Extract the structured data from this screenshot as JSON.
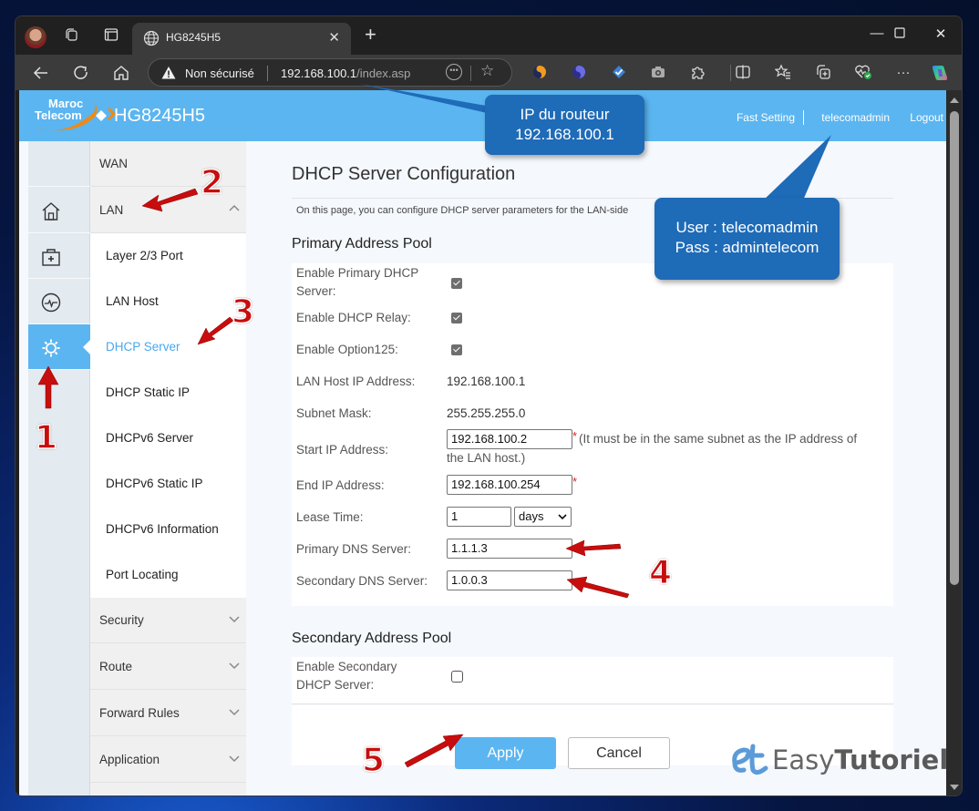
{
  "browser": {
    "tab_title": "HG8245H5",
    "security_label": "Non sécurisé",
    "url_host": "192.168.100.1",
    "url_path": "/index.asp",
    "icons": [
      "profile-avatar",
      "workspaces-icon",
      "vertical-tabs-icon",
      "globe-icon",
      "close-icon",
      "new-tab-icon",
      "minimize-icon",
      "maximize-icon",
      "window-close-icon",
      "back-icon",
      "refresh-icon",
      "home-icon",
      "warning-icon",
      "more-options-icon",
      "favorite-star-icon",
      "extension-icons",
      "split-screen-icon",
      "favorites-icon",
      "collections-icon",
      "browser-essentials-icon",
      "settings-more-icon",
      "copilot-icon"
    ]
  },
  "header": {
    "brand_line1": "Maroc",
    "brand_line2": "Telecom",
    "model": "HG8245H5",
    "links": {
      "fast_setting": "Fast Setting",
      "user": "telecomadmin",
      "logout": "Logout"
    },
    "accent": "#5bb5f0"
  },
  "iconbar": {
    "items": [
      {
        "name": "home-icon",
        "active": false
      },
      {
        "name": "diagnose-kit-icon",
        "active": false
      },
      {
        "name": "status-monitor-icon",
        "active": false
      },
      {
        "name": "gear-icon",
        "active": true
      }
    ]
  },
  "menu": {
    "groups": [
      {
        "label": "WAN",
        "expanded": false
      },
      {
        "label": "LAN",
        "expanded": true
      },
      {
        "label": "Security",
        "expanded": false
      },
      {
        "label": "Route",
        "expanded": false
      },
      {
        "label": "Forward Rules",
        "expanded": false
      },
      {
        "label": "Application",
        "expanded": false
      }
    ],
    "lan_subitems": [
      {
        "label": "Layer 2/3 Port",
        "active": false
      },
      {
        "label": "LAN Host",
        "active": false
      },
      {
        "label": "DHCP Server",
        "active": true
      },
      {
        "label": "DHCP Static IP",
        "active": false
      },
      {
        "label": "DHCPv6 Server",
        "active": false
      },
      {
        "label": "DHCPv6 Static IP",
        "active": false
      },
      {
        "label": "DHCPv6 Information",
        "active": false
      },
      {
        "label": "Port Locating",
        "active": false
      }
    ]
  },
  "content": {
    "title": "DHCP Server Configuration",
    "description": "On this page, you can configure DHCP server parameters for the LAN-side",
    "primary": {
      "title": "Primary Address Pool",
      "enable_primary_label_1": "Enable Primary DHCP",
      "enable_primary_label_2": "Server:",
      "enable_primary": true,
      "enable_relay_label": "Enable DHCP Relay:",
      "enable_relay": true,
      "enable_option125_label": "Enable Option125:",
      "enable_option125": true,
      "lan_host_ip_label": "LAN Host IP Address:",
      "lan_host_ip": "192.168.100.1",
      "subnet_mask_label": "Subnet Mask:",
      "subnet_mask": "255.255.255.0",
      "start_ip_label": "Start IP Address:",
      "start_ip": "192.168.100.2",
      "start_ip_hint_1": "(It must be in the same subnet as the IP address of",
      "start_ip_hint_2": "the LAN host.)",
      "end_ip_label": "End IP Address:",
      "end_ip": "192.168.100.254",
      "required_mark": "*",
      "lease_time_label": "Lease Time:",
      "lease_time": "1",
      "lease_unit": "days",
      "primary_dns_label": "Primary DNS Server:",
      "primary_dns": "1.1.1.3",
      "secondary_dns_label": "Secondary DNS Server:",
      "secondary_dns": "1.0.0.3"
    },
    "secondary": {
      "title": "Secondary Address Pool",
      "enable_label_1": "Enable Secondary",
      "enable_label_2": "DHCP Server:",
      "enabled": false
    },
    "buttons": {
      "apply": "Apply",
      "cancel": "Cancel"
    }
  },
  "annotations": {
    "callout_ip_1": "IP du routeur",
    "callout_ip_2": "192.168.100.1",
    "callout_user_1": "User : telecomadmin",
    "callout_user_2": "Pass : admintelecom",
    "steps": [
      "1",
      "2",
      "3",
      "4",
      "5"
    ],
    "arrow_color": "#c70d0d",
    "callout_color": "#1e6bb8"
  },
  "watermark": {
    "text_light": "Easy",
    "text_bold": "Tutoriel"
  }
}
